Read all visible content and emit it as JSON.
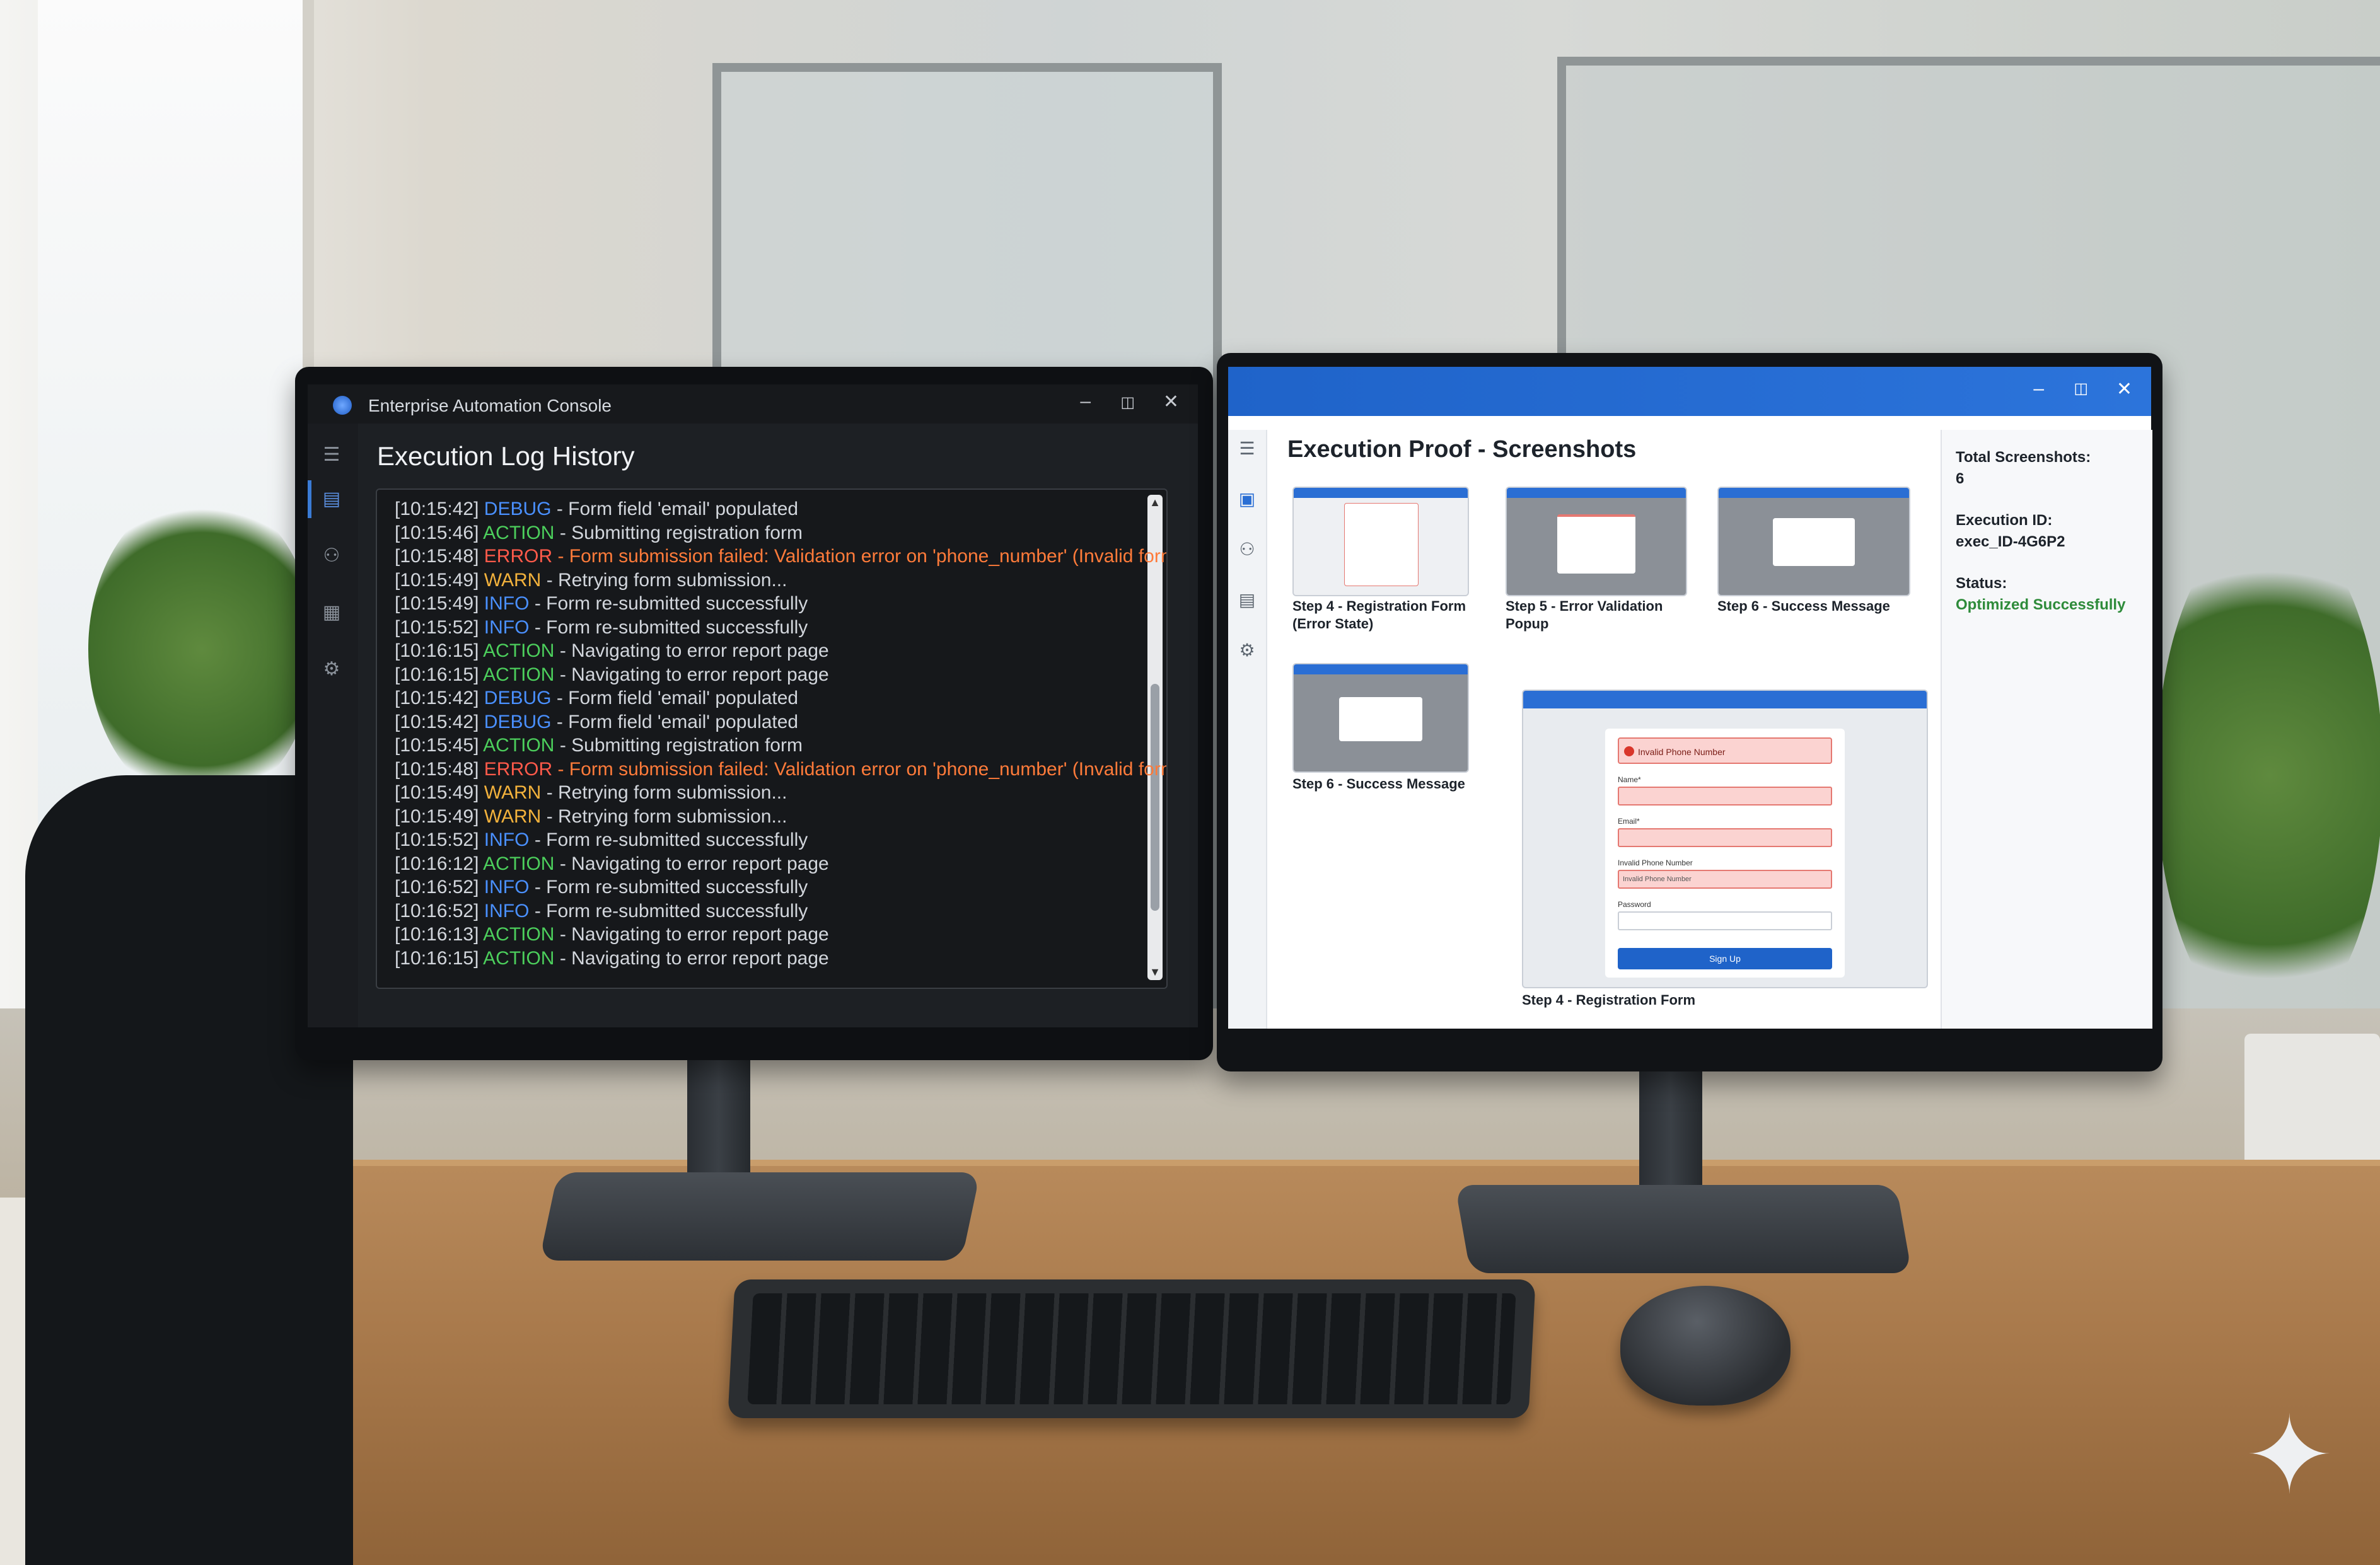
{
  "left_window": {
    "app_title": "Enterprise Automation Console",
    "heading": "Execution Log History",
    "sidebar_icons": [
      "menu-icon",
      "calendar-icon",
      "nodes-icon",
      "grid-icon",
      "gear-icon"
    ],
    "log_lines": [
      {
        "time": "[10:15:42]",
        "level": "DEBUG",
        "message": "- Form field 'email' populated"
      },
      {
        "time": "[10:15:46]",
        "level": "ACTION",
        "message": "- Submitting registration form"
      },
      {
        "time": "[10:15:48]",
        "level": "ERROR",
        "message": "- Form submission failed: Validation error on 'phone_number' (Invalid format)"
      },
      {
        "time": "[10:15:49]",
        "level": "WARN",
        "message": "- Retrying form submission..."
      },
      {
        "time": "[10:15:49]",
        "level": "INFO",
        "message": "- Form re-submitted successfully"
      },
      {
        "time": "[10:15:52]",
        "level": "INFO",
        "message": "- Form re-submitted successfully"
      },
      {
        "time": "[10:16:15]",
        "level": "ACTION",
        "message": "- Navigating to error report page"
      },
      {
        "time": "[10:16:15]",
        "level": "ACTION",
        "message": "- Navigating to error report page"
      },
      {
        "time": "[10:15:42]",
        "level": "DEBUG",
        "message": "- Form field 'email' populated"
      },
      {
        "time": "[10:15:42]",
        "level": "DEBUG",
        "message": "- Form field 'email' populated"
      },
      {
        "time": "[10:15:45]",
        "level": "ACTION",
        "message": "- Submitting registration form"
      },
      {
        "time": "[10:15:48]",
        "level": "ERROR",
        "message": "- Form submission failed: Validation error on 'phone_number' (Invalid format)"
      },
      {
        "time": "[10:15:49]",
        "level": "WARN",
        "message": "- Retrying form submission..."
      },
      {
        "time": "[10:15:49]",
        "level": "WARN",
        "message": "- Retrying form submission..."
      },
      {
        "time": "[10:15:52]",
        "level": "INFO",
        "message": "- Form re-submitted successfully"
      },
      {
        "time": "[10:16:12]",
        "level": "ACTION",
        "message": "- Navigating to error report page"
      },
      {
        "time": "[10:16:52]",
        "level": "INFO",
        "message": "- Form re-submitted successfully"
      },
      {
        "time": "[10:16:52]",
        "level": "INFO",
        "message": "- Form re-submitted successfully"
      },
      {
        "time": "[10:16:13]",
        "level": "ACTION",
        "message": "- Navigating to error report page"
      },
      {
        "time": "[10:16:15]",
        "level": "ACTION",
        "message": "- Navigating to error report page"
      }
    ]
  },
  "right_window": {
    "heading": "Execution Proof - Screenshots",
    "thumbnails": [
      {
        "caption": "Step 4 - Registration Form (Error State)"
      },
      {
        "caption": "Step 5 - Error Validation Popup"
      },
      {
        "caption": "Step 6 - Success Message"
      },
      {
        "caption": "Step 6 - Success Message"
      }
    ],
    "preview": {
      "caption": "Step 4 - Registration Form",
      "error_banner": "Invalid Phone Number",
      "fields": [
        {
          "label": "Name*",
          "value": ""
        },
        {
          "label": "Email*",
          "value": ""
        },
        {
          "label": "Invalid Phone Number",
          "value": "Invalid Phone Number"
        },
        {
          "label": "Password",
          "value": ""
        }
      ],
      "button": "Sign Up"
    },
    "info": {
      "screenshots_label": "Total Screenshots:",
      "screenshots_value": "6",
      "execution_label": "Execution ID:",
      "execution_value": "exec_ID-4G6P2",
      "status_label": "Status:",
      "status_value": "Optimized Successfully"
    }
  },
  "colors": {
    "debug": "#4a90ff",
    "action": "#4ccf5c",
    "error": "#ff5a4a",
    "warn": "#f3b23c",
    "info": "#4a90ff",
    "accent": "#1f63c9",
    "success": "#2e8b3a"
  }
}
